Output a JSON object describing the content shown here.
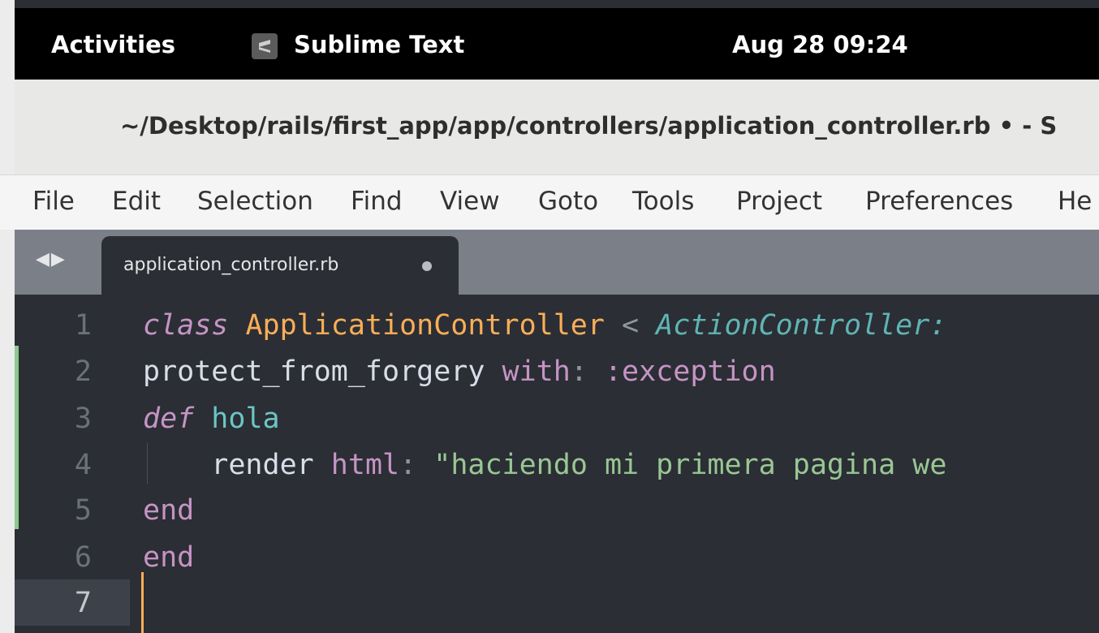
{
  "system_bar": {
    "activities": "Activities",
    "app_name": "Sublime Text",
    "clock": "Aug 28  09:24"
  },
  "window": {
    "title": "~/Desktop/rails/first_app/app/controllers/application_controller.rb • - S"
  },
  "menu": [
    "File",
    "Edit",
    "Selection",
    "Find",
    "View",
    "Goto",
    "Tools",
    "Project",
    "Preferences",
    "He"
  ],
  "tabs": [
    {
      "label": "application_controller.rb",
      "dirty": true
    }
  ],
  "editor": {
    "current_line": 7,
    "lines": [
      {
        "n": "1",
        "tokens": [
          {
            "t": "class",
            "c": "kw"
          },
          {
            "t": " ",
            "c": ""
          },
          {
            "t": "ApplicationController",
            "c": "cls"
          },
          {
            "t": " < ",
            "c": "op"
          },
          {
            "t": "ActionController:",
            "c": "inherit"
          }
        ]
      },
      {
        "n": "2",
        "tokens": [
          {
            "t": "protect_from_forgery ",
            "c": ""
          },
          {
            "t": "with",
            "c": "sym"
          },
          {
            "t": ": ",
            "c": "op"
          },
          {
            "t": ":exception",
            "c": "sym"
          }
        ]
      },
      {
        "n": "3",
        "tokens": [
          {
            "t": "def",
            "c": "kw"
          },
          {
            "t": " ",
            "c": ""
          },
          {
            "t": "hola",
            "c": "fn"
          }
        ]
      },
      {
        "n": "4",
        "tokens": [
          {
            "t": "    render ",
            "c": ""
          },
          {
            "t": "html",
            "c": "sym"
          },
          {
            "t": ": ",
            "c": "op"
          },
          {
            "t": "\"haciendo mi primera pagina we",
            "c": "str"
          }
        ]
      },
      {
        "n": "5",
        "tokens": [
          {
            "t": "end",
            "c": "end"
          }
        ]
      },
      {
        "n": "6",
        "tokens": [
          {
            "t": "end",
            "c": "end"
          }
        ]
      },
      {
        "n": "7",
        "tokens": []
      }
    ]
  },
  "colors": {
    "editor_bg": "#2b2e34",
    "keyword": "#c594c5",
    "class_name": "#f9ae58",
    "string": "#99c794",
    "modified_marker": "#8dc891"
  }
}
